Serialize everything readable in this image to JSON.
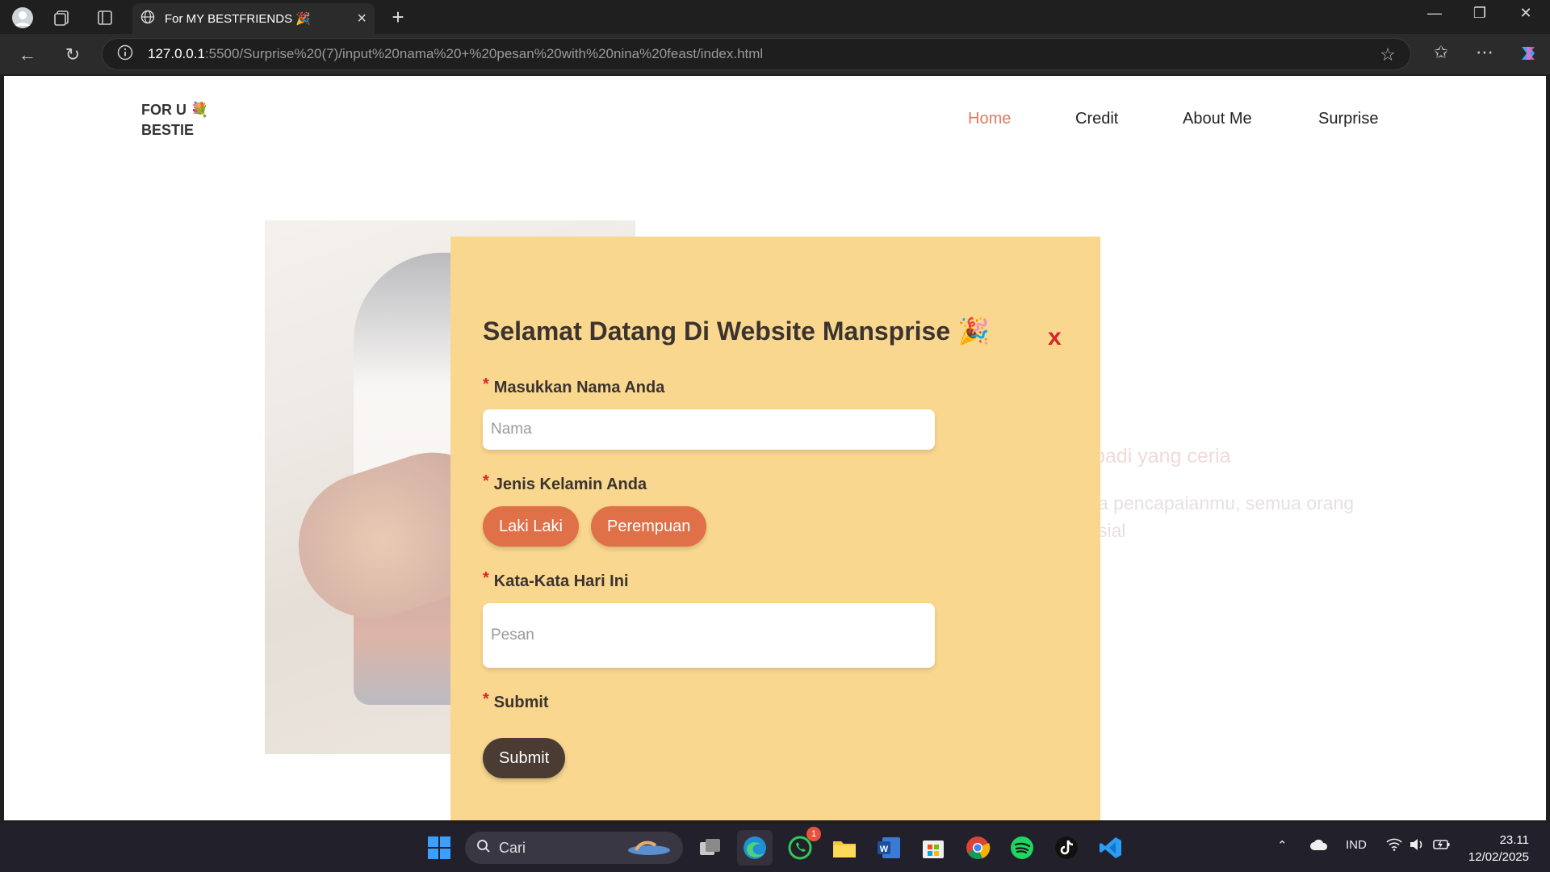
{
  "browser": {
    "tab_title": "For MY BESTFRIENDS 🎉",
    "url_host": "127.0.0.1",
    "url_path": ":5500/Surprise%20(7)/input%20nama%20+%20pesan%20with%20nina%20feast/index.html",
    "tab_close": "×",
    "new_tab": "+"
  },
  "site": {
    "logo_line1": "FOR U 💐",
    "logo_line2": "BESTIE",
    "nav": [
      {
        "label": "Home",
        "active": true
      },
      {
        "label": "Credit",
        "active": false
      },
      {
        "label": "About Me",
        "active": false
      },
      {
        "label": "Surprise",
        "active": false
      }
    ],
    "bg_heading_fragment": "badi yang ceria",
    "bg_paragraph_line1": "a pencapaianmu, semua orang",
    "bg_paragraph_line2": "sial"
  },
  "modal": {
    "title": "Selamat Datang Di Website Mansprise 🎉",
    "close_label": "x",
    "required_mark": "*",
    "name_label": "Masukkan Nama Anda",
    "name_placeholder": "Nama",
    "gender_label": "Jenis Kelamin Anda",
    "gender_options": [
      "Laki Laki",
      "Perempuan"
    ],
    "message_label": "Kata-Kata Hari Ini",
    "message_placeholder": "Pesan",
    "submit_label_heading": "Submit",
    "submit_button": "Submit"
  },
  "taskbar": {
    "search_label": "Cari",
    "whatsapp_badge": "1",
    "language": "IND",
    "time": "23.11",
    "date": "12/02/2025"
  },
  "colors": {
    "modal_bg": "#f9d78e",
    "accent_orange": "#e07048",
    "nav_active": "#e07a5f",
    "submit_dark": "#4a3b33",
    "close_red": "#d8262a"
  }
}
